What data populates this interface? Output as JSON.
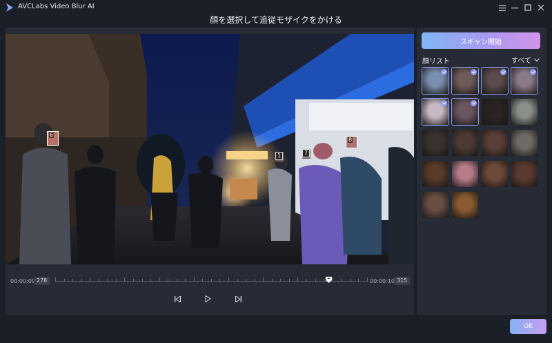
{
  "app": {
    "title": "AVCLabs Video Blur AI",
    "page_title": "顔を選択して追従モザイクをかける"
  },
  "window_controls": {
    "menu_icon": "hamburger-icon",
    "minimize_icon": "minimize-icon",
    "maximize_icon": "maximize-icon",
    "close_icon": "close-icon"
  },
  "video": {
    "face_labels": [
      "6",
      "1",
      "7",
      "8"
    ]
  },
  "timeline": {
    "start_time": "00:00:09",
    "start_frame": "278",
    "end_time": "00:00:10",
    "end_frame": "315"
  },
  "playback": {
    "prev_icon": "skip-previous-icon",
    "play_icon": "play-icon",
    "next_icon": "skip-next-icon"
  },
  "side": {
    "scan_button": "スキャン開始",
    "face_list_title": "顔リスト",
    "filter_label": "すべて",
    "faces": [
      {
        "id": 1,
        "selected": true
      },
      {
        "id": 2,
        "selected": true
      },
      {
        "id": 3,
        "selected": true
      },
      {
        "id": 4,
        "selected": true
      },
      {
        "id": 5,
        "selected": true
      },
      {
        "id": 6,
        "selected": true
      },
      {
        "id": 7,
        "selected": false
      },
      {
        "id": 8,
        "selected": false
      },
      {
        "id": 9,
        "selected": false
      },
      {
        "id": 10,
        "selected": false
      },
      {
        "id": 11,
        "selected": false
      },
      {
        "id": 12,
        "selected": false
      },
      {
        "id": 13,
        "selected": false
      },
      {
        "id": 14,
        "selected": false
      },
      {
        "id": 15,
        "selected": false
      },
      {
        "id": 16,
        "selected": false
      },
      {
        "id": 17,
        "selected": false
      },
      {
        "id": 18,
        "selected": false
      }
    ]
  },
  "footer": {
    "ok_button": "OK"
  },
  "colors": {
    "background": "#1b1f27",
    "panel": "#262b35",
    "accent_start": "#7fb6f5",
    "accent_end": "#d393ea",
    "check": "#8f9cf3"
  }
}
